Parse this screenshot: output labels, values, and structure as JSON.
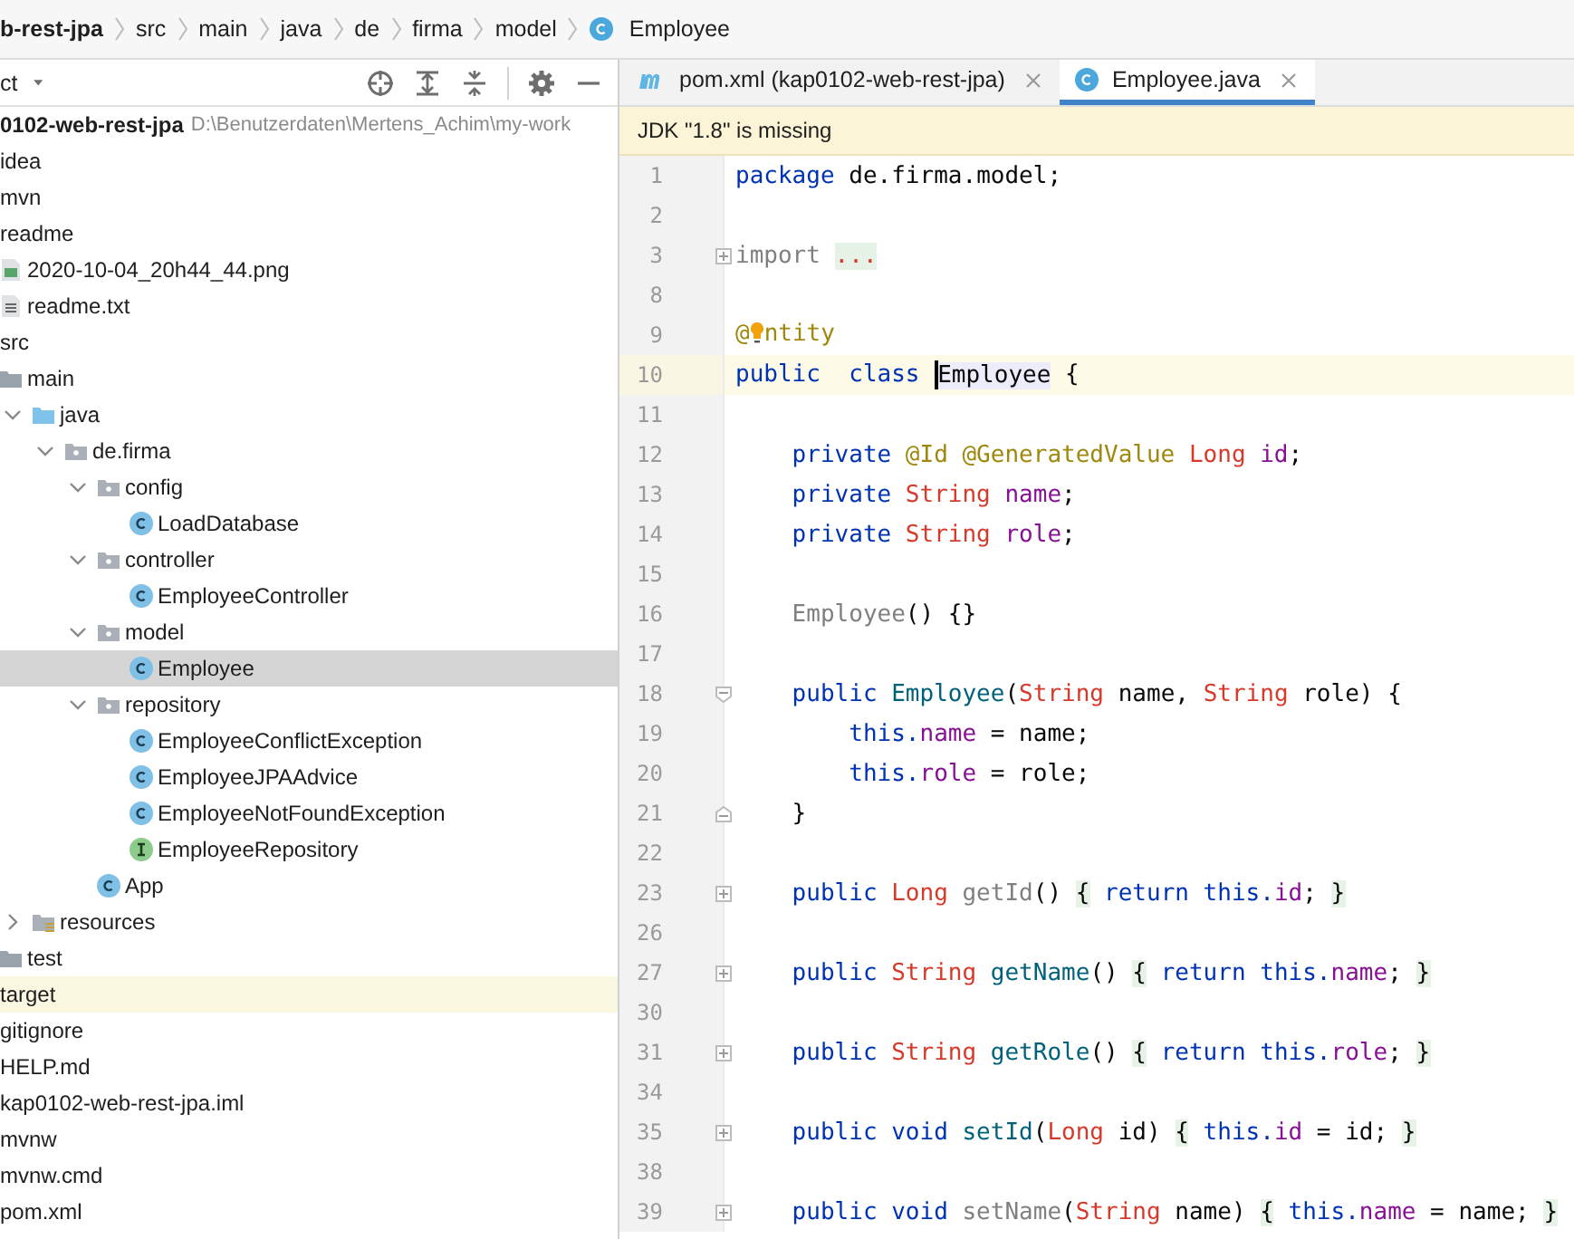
{
  "breadcrumb": [
    {
      "label": "b-rest-jpa",
      "kind": "project"
    },
    {
      "label": "src",
      "kind": "folder"
    },
    {
      "label": "main",
      "kind": "folder"
    },
    {
      "label": "java",
      "kind": "folder"
    },
    {
      "label": "de",
      "kind": "folder"
    },
    {
      "label": "firma",
      "kind": "folder"
    },
    {
      "label": "model",
      "kind": "folder"
    },
    {
      "label": "Employee",
      "kind": "class"
    }
  ],
  "project_panel": {
    "title": "ct",
    "tree": [
      {
        "label": "0102-web-rest-jpa",
        "path": "D:\\Benutzerdaten\\Mertens_Achim\\my-work",
        "selected": false,
        "highlighted": false,
        "children": [
          {
            "label": "idea",
            "selected": false,
            "highlighted": false
          },
          {
            "label": "mvn",
            "selected": false,
            "highlighted": false
          },
          {
            "label": "readme",
            "selected": false,
            "highlighted": false,
            "children": [
              {
                "label": "2020-10-04_20h44_44.png",
                "kind": "image",
                "selected": false,
                "highlighted": false
              },
              {
                "label": "readme.txt",
                "kind": "text",
                "selected": false,
                "highlighted": false
              }
            ]
          },
          {
            "label": "src",
            "selected": false,
            "highlighted": false,
            "children": [
              {
                "label": "main",
                "kind": "folder",
                "selected": false,
                "highlighted": false,
                "children": [
                  {
                    "label": "java",
                    "kind": "source",
                    "expanded": true,
                    "selected": false,
                    "highlighted": false,
                    "children": [
                      {
                        "label": "de.firma",
                        "kind": "package",
                        "expanded": true,
                        "selected": false,
                        "highlighted": false,
                        "children": [
                          {
                            "label": "config",
                            "kind": "package",
                            "expanded": true,
                            "selected": false,
                            "highlighted": false,
                            "children": [
                              {
                                "label": "LoadDatabase",
                                "kind": "class",
                                "selected": false,
                                "highlighted": false
                              }
                            ]
                          },
                          {
                            "label": "controller",
                            "kind": "package",
                            "expanded": true,
                            "selected": false,
                            "highlighted": false,
                            "children": [
                              {
                                "label": "EmployeeController",
                                "kind": "class",
                                "selected": false,
                                "highlighted": false
                              }
                            ]
                          },
                          {
                            "label": "model",
                            "kind": "package",
                            "expanded": true,
                            "selected": false,
                            "highlighted": false,
                            "children": [
                              {
                                "label": "Employee",
                                "kind": "class",
                                "selected": true,
                                "highlighted": false
                              }
                            ]
                          },
                          {
                            "label": "repository",
                            "kind": "package",
                            "expanded": true,
                            "selected": false,
                            "highlighted": false,
                            "children": [
                              {
                                "label": "EmployeeConflictException",
                                "kind": "class",
                                "selected": false,
                                "highlighted": false
                              },
                              {
                                "label": "EmployeeJPAAdvice",
                                "kind": "class",
                                "selected": false,
                                "highlighted": false
                              },
                              {
                                "label": "EmployeeNotFoundException",
                                "kind": "class",
                                "selected": false,
                                "highlighted": false
                              },
                              {
                                "label": "EmployeeRepository",
                                "kind": "interface",
                                "selected": false,
                                "highlighted": false
                              }
                            ]
                          },
                          {
                            "label": "App",
                            "kind": "class",
                            "selected": false,
                            "highlighted": false
                          }
                        ]
                      }
                    ]
                  },
                  {
                    "label": "resources",
                    "kind": "resources",
                    "expanded": false,
                    "selected": false,
                    "highlighted": false
                  }
                ]
              },
              {
                "label": "test",
                "kind": "folder",
                "selected": false,
                "highlighted": false
              }
            ]
          },
          {
            "label": "target",
            "selected": false,
            "highlighted": true
          },
          {
            "label": "gitignore",
            "selected": false,
            "highlighted": false
          },
          {
            "label": "HELP.md",
            "selected": false,
            "highlighted": false
          },
          {
            "label": "kap0102-web-rest-jpa.iml",
            "selected": false,
            "highlighted": false
          },
          {
            "label": "mvnw",
            "selected": false,
            "highlighted": false
          },
          {
            "label": "mvnw.cmd",
            "selected": false,
            "highlighted": false
          },
          {
            "label": "pom.xml",
            "selected": false,
            "highlighted": false
          }
        ]
      }
    ]
  },
  "editor": {
    "tabs": [
      {
        "label": "pom.xml (kap0102-web-rest-jpa)",
        "kind": "maven",
        "selected": false
      },
      {
        "label": "Employee.java",
        "kind": "class",
        "selected": true
      }
    ],
    "banner": "JDK \"1.8\" is missing",
    "lines": [
      {
        "number": "1",
        "kind": "plain",
        "current": false,
        "tokens": [
          {
            "kind": "kw",
            "text": "package"
          },
          {
            "kind": "plain",
            "text": " de.firma.model;"
          }
        ]
      },
      {
        "number": "2",
        "kind": "plain",
        "current": false
      },
      {
        "number": "3",
        "kind": "fold-plus",
        "current": false,
        "tokens": [
          {
            "kind": "unused",
            "text": "import "
          },
          {
            "kind": "dots",
            "text": "..."
          }
        ]
      },
      {
        "number": "8",
        "kind": "plain",
        "current": false
      },
      {
        "number": "9",
        "kind": "plain",
        "current": false,
        "tokens": [
          {
            "kind": "ann",
            "text": "@"
          },
          {
            "kind": "bulb"
          },
          {
            "kind": "ann",
            "text": "ntity"
          }
        ]
      },
      {
        "number": "10",
        "kind": "plain",
        "current": true,
        "tokens": [
          {
            "kind": "kw",
            "text": "public  class "
          },
          {
            "kind": "caret"
          },
          {
            "kind": "ident",
            "text": "Employee"
          },
          {
            "kind": "plain",
            "text": " {"
          }
        ]
      },
      {
        "number": "11",
        "kind": "plain",
        "current": false
      },
      {
        "number": "12",
        "kind": "plain",
        "current": false,
        "tokens": [
          {
            "kind": "kw",
            "text": "    private "
          },
          {
            "kind": "ann",
            "text": "@Id @GeneratedValue "
          },
          {
            "kind": "type",
            "text": "Long "
          },
          {
            "kind": "field",
            "text": "id"
          },
          {
            "kind": "plain",
            "text": ";"
          }
        ]
      },
      {
        "number": "13",
        "kind": "plain",
        "current": false,
        "tokens": [
          {
            "kind": "kw",
            "text": "    private "
          },
          {
            "kind": "type",
            "text": "String "
          },
          {
            "kind": "field",
            "text": "name"
          },
          {
            "kind": "plain",
            "text": ";"
          }
        ]
      },
      {
        "number": "14",
        "kind": "plain",
        "current": false,
        "tokens": [
          {
            "kind": "kw",
            "text": "    private "
          },
          {
            "kind": "type",
            "text": "String "
          },
          {
            "kind": "field",
            "text": "role"
          },
          {
            "kind": "plain",
            "text": ";"
          }
        ]
      },
      {
        "number": "15",
        "kind": "plain",
        "current": false
      },
      {
        "number": "16",
        "kind": "plain",
        "current": false,
        "tokens": [
          {
            "kind": "unused",
            "text": "    Employee"
          },
          {
            "kind": "plain",
            "text": "() {}"
          }
        ]
      },
      {
        "number": "17",
        "kind": "plain",
        "current": false
      },
      {
        "number": "18",
        "kind": "fold-start",
        "current": false,
        "tokens": [
          {
            "kind": "kw",
            "text": "    public "
          },
          {
            "kind": "method",
            "text": "Employee"
          },
          {
            "kind": "plain",
            "text": "("
          },
          {
            "kind": "type",
            "text": "String"
          },
          {
            "kind": "plain",
            "text": " name, "
          },
          {
            "kind": "type",
            "text": "String"
          },
          {
            "kind": "plain",
            "text": " role) {"
          }
        ]
      },
      {
        "number": "19",
        "kind": "plain",
        "current": false,
        "tokens": [
          {
            "kind": "kw",
            "text": "        this."
          },
          {
            "kind": "field",
            "text": "name"
          },
          {
            "kind": "plain",
            "text": " = name;"
          }
        ]
      },
      {
        "number": "20",
        "kind": "plain",
        "current": false,
        "tokens": [
          {
            "kind": "kw",
            "text": "        this."
          },
          {
            "kind": "field",
            "text": "role"
          },
          {
            "kind": "plain",
            "text": " = role;"
          }
        ]
      },
      {
        "number": "21",
        "kind": "fold-end",
        "current": false,
        "tokens": [
          {
            "kind": "plain",
            "text": "    }"
          }
        ]
      },
      {
        "number": "22",
        "kind": "plain",
        "current": false
      },
      {
        "number": "23",
        "kind": "fold-plus",
        "current": false,
        "tokens": [
          {
            "kind": "kw",
            "text": "    public "
          },
          {
            "kind": "type",
            "text": "Long "
          },
          {
            "kind": "unused",
            "text": "getId"
          },
          {
            "kind": "plain",
            "text": "() "
          },
          {
            "kind": "brace",
            "text": "{"
          },
          {
            "kind": "kw",
            "text": " return this."
          },
          {
            "kind": "field",
            "text": "id"
          },
          {
            "kind": "plain",
            "text": "; "
          },
          {
            "kind": "brace",
            "text": "}"
          }
        ]
      },
      {
        "number": "26",
        "kind": "plain",
        "current": false
      },
      {
        "number": "27",
        "kind": "fold-plus",
        "current": false,
        "tokens": [
          {
            "kind": "kw",
            "text": "    public "
          },
          {
            "kind": "type",
            "text": "String "
          },
          {
            "kind": "method",
            "text": "getName"
          },
          {
            "kind": "plain",
            "text": "() "
          },
          {
            "kind": "brace",
            "text": "{"
          },
          {
            "kind": "kw",
            "text": " return this."
          },
          {
            "kind": "field",
            "text": "name"
          },
          {
            "kind": "plain",
            "text": "; "
          },
          {
            "kind": "brace",
            "text": "}"
          }
        ]
      },
      {
        "number": "30",
        "kind": "plain",
        "current": false
      },
      {
        "number": "31",
        "kind": "fold-plus",
        "current": false,
        "tokens": [
          {
            "kind": "kw",
            "text": "    public "
          },
          {
            "kind": "type",
            "text": "String "
          },
          {
            "kind": "method",
            "text": "getRole"
          },
          {
            "kind": "plain",
            "text": "() "
          },
          {
            "kind": "brace",
            "text": "{"
          },
          {
            "kind": "kw",
            "text": " return this."
          },
          {
            "kind": "field",
            "text": "role"
          },
          {
            "kind": "plain",
            "text": "; "
          },
          {
            "kind": "brace",
            "text": "}"
          }
        ]
      },
      {
        "number": "34",
        "kind": "plain",
        "current": false
      },
      {
        "number": "35",
        "kind": "fold-plus",
        "current": false,
        "tokens": [
          {
            "kind": "kw",
            "text": "    public void "
          },
          {
            "kind": "method",
            "text": "setId"
          },
          {
            "kind": "plain",
            "text": "("
          },
          {
            "kind": "type",
            "text": "Long"
          },
          {
            "kind": "plain",
            "text": " id) "
          },
          {
            "kind": "brace",
            "text": "{"
          },
          {
            "kind": "kw",
            "text": " this."
          },
          {
            "kind": "field",
            "text": "id"
          },
          {
            "kind": "plain",
            "text": " = id; "
          },
          {
            "kind": "brace",
            "text": "}"
          }
        ]
      },
      {
        "number": "38",
        "kind": "plain",
        "current": false
      },
      {
        "number": "39",
        "kind": "fold-plus",
        "current": false,
        "tokens": [
          {
            "kind": "kw",
            "text": "    public void "
          },
          {
            "kind": "unused",
            "text": "setName"
          },
          {
            "kind": "plain",
            "text": "("
          },
          {
            "kind": "type",
            "text": "String"
          },
          {
            "kind": "plain",
            "text": " name) "
          },
          {
            "kind": "brace",
            "text": "{"
          },
          {
            "kind": "kw",
            "text": " this."
          },
          {
            "kind": "field",
            "text": "name"
          },
          {
            "kind": "plain",
            "text": " = name; "
          },
          {
            "kind": "brace",
            "text": "}"
          }
        ]
      }
    ]
  }
}
